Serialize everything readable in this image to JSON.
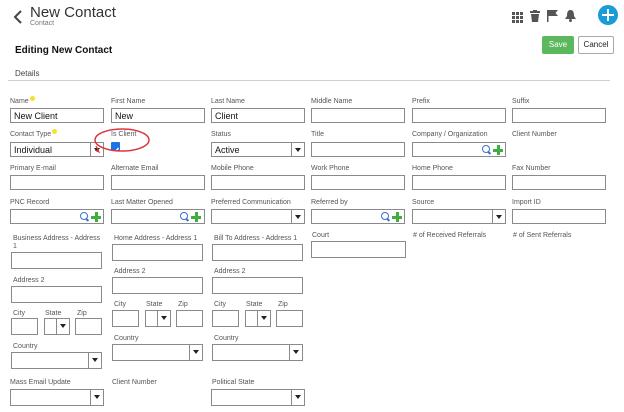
{
  "header": {
    "title": "New Contact",
    "subtitle": "Contact",
    "section_title": "Editing New Contact",
    "tab": "Details",
    "save_label": "Save",
    "cancel_label": "Cancel"
  },
  "colors": {
    "accent": "#1a9cd8",
    "save": "#5cb85c",
    "plus": "#3fae3f",
    "search": "#3a6fd6",
    "required": "#f5e12a",
    "annotation": "#d9363e"
  },
  "fields": {
    "name": {
      "label": "Name",
      "value": "New Client"
    },
    "first_name": {
      "label": "First Name",
      "value": "New"
    },
    "last_name": {
      "label": "Last Name",
      "value": "Client"
    },
    "middle_name": {
      "label": "Middle Name",
      "value": ""
    },
    "prefix": {
      "label": "Prefix",
      "value": ""
    },
    "suffix": {
      "label": "Suffix",
      "value": ""
    },
    "contact_type": {
      "label": "Contact Type",
      "value": "Individual"
    },
    "is_client": {
      "label": "Is Client",
      "checked": true
    },
    "status": {
      "label": "Status",
      "value": "Active"
    },
    "title": {
      "label": "Title",
      "value": ""
    },
    "company": {
      "label": "Company / Organization",
      "value": ""
    },
    "client_number": {
      "label": "Client Number"
    },
    "primary_email": {
      "label": "Primary E-mail",
      "value": ""
    },
    "alternate_email": {
      "label": "Alternate Email",
      "value": ""
    },
    "mobile_phone": {
      "label": "Mobile Phone",
      "value": ""
    },
    "work_phone": {
      "label": "Work Phone",
      "value": ""
    },
    "home_phone": {
      "label": "Home Phone",
      "value": ""
    },
    "fax_number": {
      "label": "Fax Number",
      "value": ""
    },
    "pnc_record": {
      "label": "PNC Record",
      "value": ""
    },
    "last_matter_opened": {
      "label": "Last Matter Opened",
      "value": ""
    },
    "preferred_communication": {
      "label": "Preferred Communication",
      "value": ""
    },
    "referred_by": {
      "label": "Referred by",
      "value": ""
    },
    "source": {
      "label": "Source",
      "value": ""
    },
    "import_id": {
      "label": "Import ID",
      "value": ""
    },
    "business_address_1": {
      "label": "Business Address - Address 1",
      "value": ""
    },
    "home_address_1": {
      "label": "Home Address - Address 1",
      "value": ""
    },
    "bill_to_address_1": {
      "label": "Bill To Address - Address 1",
      "value": ""
    },
    "court": {
      "label": "Court",
      "value": ""
    },
    "received_referrals": {
      "label": "# of Received Referrals"
    },
    "sent_referrals": {
      "label": "# of Sent Referrals"
    },
    "address_2": {
      "label": "Address 2"
    },
    "city": {
      "label": "City"
    },
    "state": {
      "label": "State"
    },
    "zip": {
      "label": "Zip"
    },
    "country": {
      "label": "Country"
    },
    "mass_email_update": {
      "label": "Mass Email Update",
      "value": ""
    },
    "client_number_2": {
      "label": "Client Number"
    },
    "political_state": {
      "label": "Political State",
      "value": ""
    }
  }
}
